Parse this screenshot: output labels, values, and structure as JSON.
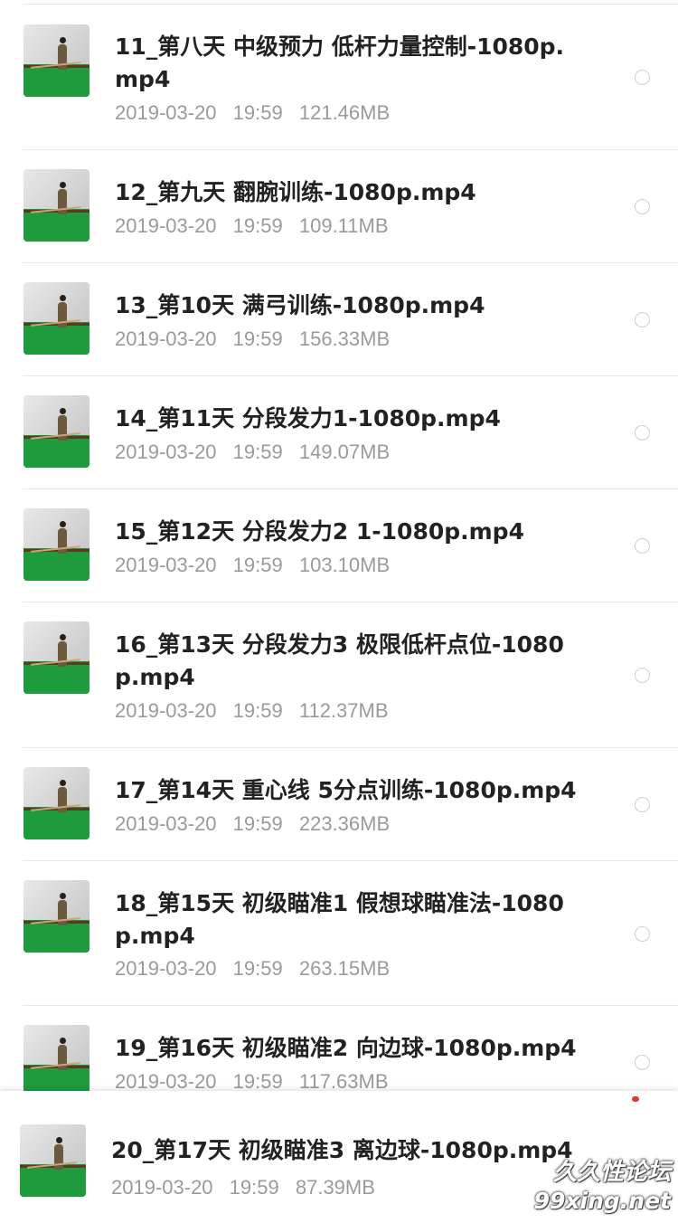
{
  "files": [
    {
      "title": "11_第八天 中级预力 低杆力量控制-1080p.mp4",
      "date": "2019-03-20",
      "time": "19:59",
      "size": "121.46MB"
    },
    {
      "title": "12_第九天 翻腕训练-1080p.mp4",
      "date": "2019-03-20",
      "time": "19:59",
      "size": "109.11MB"
    },
    {
      "title": "13_第10天 满弓训练-1080p.mp4",
      "date": "2019-03-20",
      "time": "19:59",
      "size": "156.33MB"
    },
    {
      "title": "14_第11天 分段发力1-1080p.mp4",
      "date": "2019-03-20",
      "time": "19:59",
      "size": "149.07MB"
    },
    {
      "title": "15_第12天 分段发力2 1-1080p.mp4",
      "date": "2019-03-20",
      "time": "19:59",
      "size": "103.10MB"
    },
    {
      "title": "16_第13天 分段发力3 极限低杆点位-1080p.mp4",
      "date": "2019-03-20",
      "time": "19:59",
      "size": "112.37MB"
    },
    {
      "title": "17_第14天 重心线  5分点训练-1080p.mp4",
      "date": "2019-03-20",
      "time": "19:59",
      "size": "223.36MB"
    },
    {
      "title": "18_第15天 初级瞄准1  假想球瞄准法-1080p.mp4",
      "date": "2019-03-20",
      "time": "19:59",
      "size": "263.15MB"
    },
    {
      "title": "19_第16天 初级瞄准2 向边球-1080p.mp4",
      "date": "2019-03-20",
      "time": "19:59",
      "size": "117.63MB"
    },
    {
      "title": "20_第17天 初级瞄准3 离边球-1080p.mp4",
      "date": "2019-03-20",
      "time": "19:59",
      "size": "87.39MB"
    }
  ],
  "watermark": {
    "line1": "久久性论坛",
    "line2": "99xing.net"
  },
  "colors": {
    "title": "#222222",
    "meta": "#9a9a9a",
    "table_green": "#1d9b3d",
    "badge_red": "#e53935"
  },
  "icons": {
    "thumbnail": "video-thumbnail-icon",
    "select": "radio-circle-icon"
  }
}
